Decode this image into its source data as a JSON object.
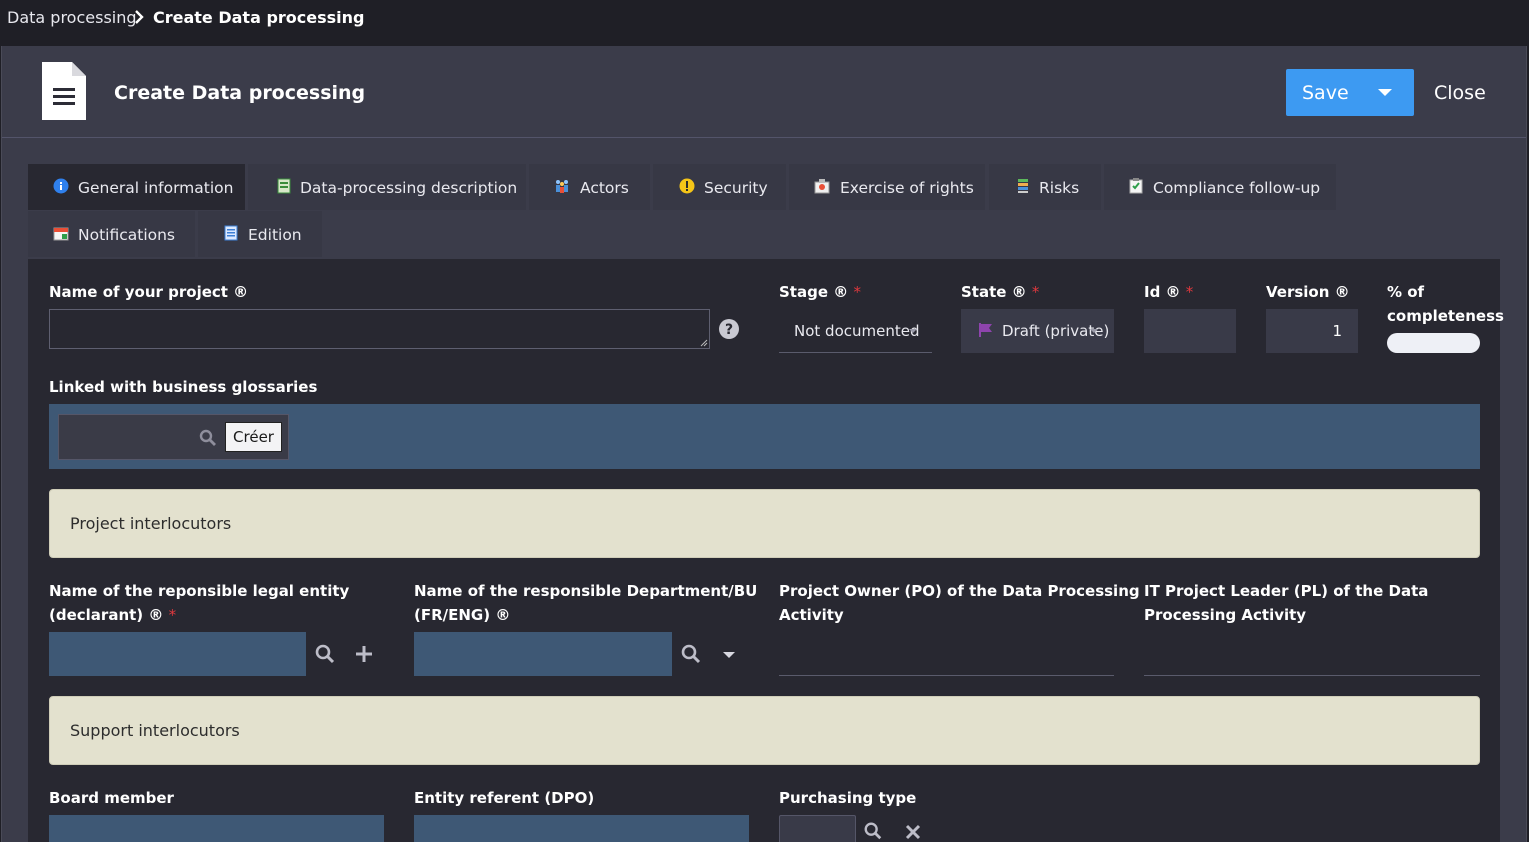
{
  "breadcrumb": {
    "parent": "Data processing",
    "current": "Create Data processing"
  },
  "header": {
    "title": "Create Data processing",
    "save_label": "Save",
    "close_label": "Close"
  },
  "tabs": [
    {
      "label": "General information",
      "icon": "info-icon"
    },
    {
      "label": "Data-processing description",
      "icon": "description-icon"
    },
    {
      "label": "Actors",
      "icon": "actors-icon"
    },
    {
      "label": "Security",
      "icon": "warning-icon"
    },
    {
      "label": "Exercise of rights",
      "icon": "rights-icon"
    },
    {
      "label": "Risks",
      "icon": "risks-icon"
    },
    {
      "label": "Compliance follow-up",
      "icon": "checklist-icon"
    },
    {
      "label": "Notifications",
      "icon": "calendar-icon"
    },
    {
      "label": "Edition",
      "icon": "edit-doc-icon"
    }
  ],
  "form": {
    "project_name": {
      "label": "Name of your project ®",
      "value": ""
    },
    "stage": {
      "label": "Stage ®",
      "value": "Not documented"
    },
    "state": {
      "label": "State ®",
      "value": "Draft (private)",
      "flag_color": "#8e44ad"
    },
    "id": {
      "label": "Id ®",
      "value": ""
    },
    "version": {
      "label": "Version ®",
      "value": "1"
    },
    "completeness": {
      "label_line1": "% of",
      "label_line2": "completeness"
    },
    "glossaries": {
      "label": "Linked with business glossaries",
      "create_label": "Créer"
    },
    "project_interlocutors": "Project interlocutors",
    "legal_entity": {
      "label_line1": "Name of the reponsible legal entity",
      "label_line2": "(declarant) ®"
    },
    "department": {
      "label_line1": "Name of the responsible Department/BU",
      "label_line2": "(FR/ENG) ®"
    },
    "project_owner": {
      "label_line1": "Project Owner (PO) of the Data Processing",
      "label_line2": "Activity"
    },
    "it_leader": {
      "label_line1": "IT Project Leader (PL) of the Data",
      "label_line2": "Processing Activity"
    },
    "support_interlocutors": "Support interlocutors",
    "board_member": {
      "label": "Board member"
    },
    "entity_referent": {
      "label": "Entity referent (DPO)"
    },
    "purchasing_type": {
      "label": "Purchasing type"
    }
  },
  "required_mark": "*",
  "colors": {
    "accent": "#3d9af2",
    "required": "#e0393e",
    "section_bg": "#e3e1ce",
    "input_blue": "#3e5875"
  }
}
